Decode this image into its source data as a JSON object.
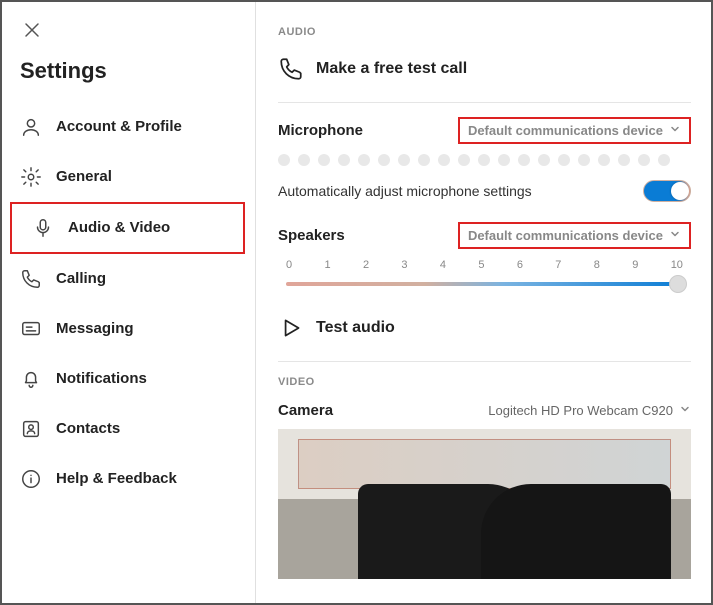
{
  "title": "Settings",
  "sidebar": {
    "items": [
      {
        "label": "Account & Profile",
        "icon": "user"
      },
      {
        "label": "General",
        "icon": "gear"
      },
      {
        "label": "Audio & Video",
        "icon": "mic"
      },
      {
        "label": "Calling",
        "icon": "phone"
      },
      {
        "label": "Messaging",
        "icon": "message"
      },
      {
        "label": "Notifications",
        "icon": "bell"
      },
      {
        "label": "Contacts",
        "icon": "contacts"
      },
      {
        "label": "Help & Feedback",
        "icon": "info"
      }
    ],
    "active_index": 2
  },
  "audio": {
    "section": "AUDIO",
    "test_call": "Make a free test call",
    "microphone_label": "Microphone",
    "microphone_device": "Default communications device",
    "auto_adjust": "Automatically adjust microphone settings",
    "auto_adjust_on": true,
    "speakers_label": "Speakers",
    "speakers_device": "Default communications device",
    "speakers_ticks": [
      "0",
      "1",
      "2",
      "3",
      "4",
      "5",
      "6",
      "7",
      "8",
      "9",
      "10"
    ],
    "speakers_value": 10,
    "test_audio": "Test audio"
  },
  "video": {
    "section": "VIDEO",
    "camera_label": "Camera",
    "camera_device": "Logitech HD Pro Webcam C920"
  }
}
